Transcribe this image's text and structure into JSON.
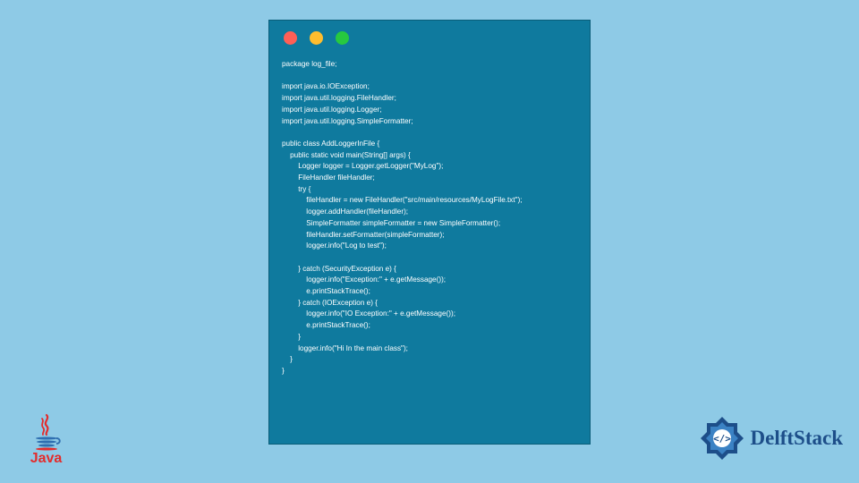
{
  "window": {
    "lights": [
      "red",
      "yellow",
      "green"
    ]
  },
  "code": {
    "text": "package log_file;\n\nimport java.io.IOException;\nimport java.util.logging.FileHandler;\nimport java.util.logging.Logger;\nimport java.util.logging.SimpleFormatter;\n\npublic class AddLoggerInFile {\n    public static void main(String[] args) {\n        Logger logger = Logger.getLogger(\"MyLog\");\n        FileHandler fileHandler;\n        try {\n            fileHandler = new FileHandler(\"src/main/resources/MyLogFile.txt\");\n            logger.addHandler(fileHandler);\n            SimpleFormatter simpleFormatter = new SimpleFormatter();\n            fileHandler.setFormatter(simpleFormatter);\n            logger.info(\"Log to test\");\n\n        } catch (SecurityException e) {\n            logger.info(\"Exception:\" + e.getMessage());\n            e.printStackTrace();\n        } catch (IOException e) {\n            logger.info(\"IO Exception:\" + e.getMessage());\n            e.printStackTrace();\n        }\n        logger.info(\"Hi In the main class\");\n    }\n}"
  },
  "logos": {
    "java_label": "Java",
    "delft_label": "DelftStack"
  },
  "colors": {
    "page_bg": "#8ecae6",
    "window_bg": "#0f7a9e",
    "code_text": "#ffffff",
    "java_red": "#e32c2c",
    "delft_blue": "#1d4e89"
  }
}
